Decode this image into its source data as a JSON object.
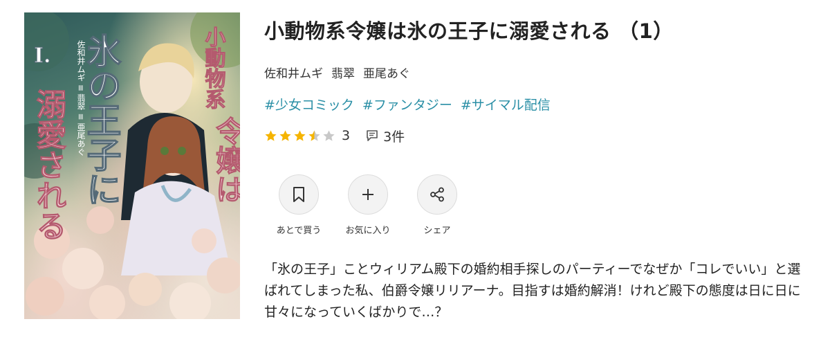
{
  "book": {
    "cover_alt": "小動物系令嬢は氷の王子に溺愛される（1）",
    "cover_text": {
      "title_main": "氷の王子に",
      "title_sub": "小動物系",
      "title_rei": "令嬢は",
      "title_dekiai": "溺愛される",
      "volume": "I.",
      "credit": "佐和井ムギ ≡ 翡翠 ≡ 亜尾あぐ"
    },
    "title": "小動物系令嬢は氷の王子に溺愛される （1）",
    "authors": [
      "佐和井ムギ",
      "翡翠",
      "亜尾あぐ"
    ],
    "tags": [
      "#少女コミック",
      "#ファンタジー",
      "#サイマル配信"
    ],
    "rating": {
      "value": 3.5,
      "max": 5,
      "label": "3",
      "review_count_label": "3件",
      "star_color": "#f5b400",
      "star_empty_color": "#c8c8c8"
    },
    "actions": [
      {
        "icon": "bookmark-icon",
        "label": "あとで買う"
      },
      {
        "icon": "plus-icon",
        "label": "お気に入り"
      },
      {
        "icon": "share-icon",
        "label": "シェア"
      }
    ],
    "description": "「氷の王子」ことウィリアム殿下の婚約相手探しのパーティーでなぜか「コレでいい」と選ばれてしまった私、伯爵令嬢リリアーナ。目指すは婚約解消！けれど殿下の態度は日に日に甘々になっていくばかりで…？"
  },
  "colors": {
    "tag": "#2a8fa6",
    "text": "#222222",
    "button_bg": "#f3f3f3"
  }
}
